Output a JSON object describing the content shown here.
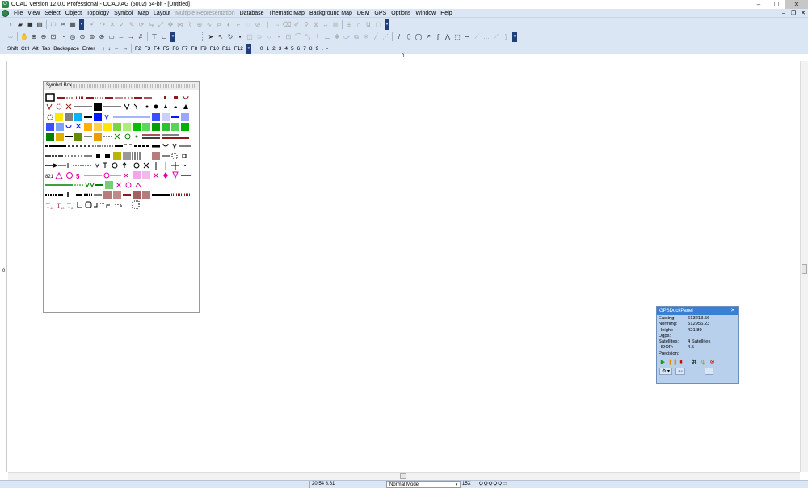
{
  "window": {
    "title": "OCAD Version 12.0.0  Professional - OCAD AG (5002) 64-bit - [Untitled]",
    "minimize": "–",
    "maximize": "☐",
    "close": "✕"
  },
  "menu": {
    "items": [
      {
        "label": "File",
        "disabled": false
      },
      {
        "label": "View",
        "disabled": false
      },
      {
        "label": "Select",
        "disabled": false
      },
      {
        "label": "Object",
        "disabled": false
      },
      {
        "label": "Topology",
        "disabled": false
      },
      {
        "label": "Symbol",
        "disabled": false
      },
      {
        "label": "Map",
        "disabled": false
      },
      {
        "label": "Layout",
        "disabled": false
      },
      {
        "label": "Multiple Representation",
        "disabled": true
      },
      {
        "label": "Database",
        "disabled": false
      },
      {
        "label": "Thematic Map",
        "disabled": false
      },
      {
        "label": "Background Map",
        "disabled": false
      },
      {
        "label": "DEM",
        "disabled": false
      },
      {
        "label": "GPS",
        "disabled": false
      },
      {
        "label": "Options",
        "disabled": false
      },
      {
        "label": "Window",
        "disabled": false
      },
      {
        "label": "Help",
        "disabled": false
      }
    ],
    "mdi_min": "–",
    "mdi_restore": "❐",
    "mdi_close": "✕"
  },
  "toolbar": {
    "keys": [
      "Shift",
      "Ctrl",
      "Alt",
      "Tab",
      "Backspace",
      "Enter"
    ],
    "arrows": [
      "↑",
      "↓",
      "←",
      "→"
    ],
    "fkeys": [
      "F2",
      "F3",
      "F4",
      "F5",
      "F6",
      "F7",
      "F8",
      "F9",
      "F10",
      "F11",
      "F12"
    ],
    "digits": [
      "0",
      "1",
      "2",
      "3",
      "4",
      "5",
      "6",
      "7",
      "8",
      "9",
      ".",
      "-"
    ]
  },
  "rulers": {
    "top_label": "0",
    "left_label": "0"
  },
  "symbol_box": {
    "title": "Symbol Box"
  },
  "gps_panel": {
    "title": "GPSDockPanel",
    "close": "✕",
    "rows": [
      {
        "label": "Easting:",
        "value": "613213.56"
      },
      {
        "label": "Northing:",
        "value": "512956.23"
      },
      {
        "label": "Height:",
        "value": "421.89"
      },
      {
        "label": "Dgps:",
        "value": ""
      },
      {
        "label": "Satellites:",
        "value": "4 Satellites"
      },
      {
        "label": "HDOP:",
        "value": "4.5"
      },
      {
        "label": "Precision:",
        "value": ""
      }
    ],
    "more": "..."
  },
  "status": {
    "coords": "20.54   8.61",
    "mode": "Normal Mode",
    "zoom": "15X"
  },
  "colors": {
    "chrome": "#dbe6f4",
    "gps_title": "#3b7fd4",
    "gps_body": "#b9d0ec",
    "toolbar_chevron": "#1e3f7a"
  }
}
